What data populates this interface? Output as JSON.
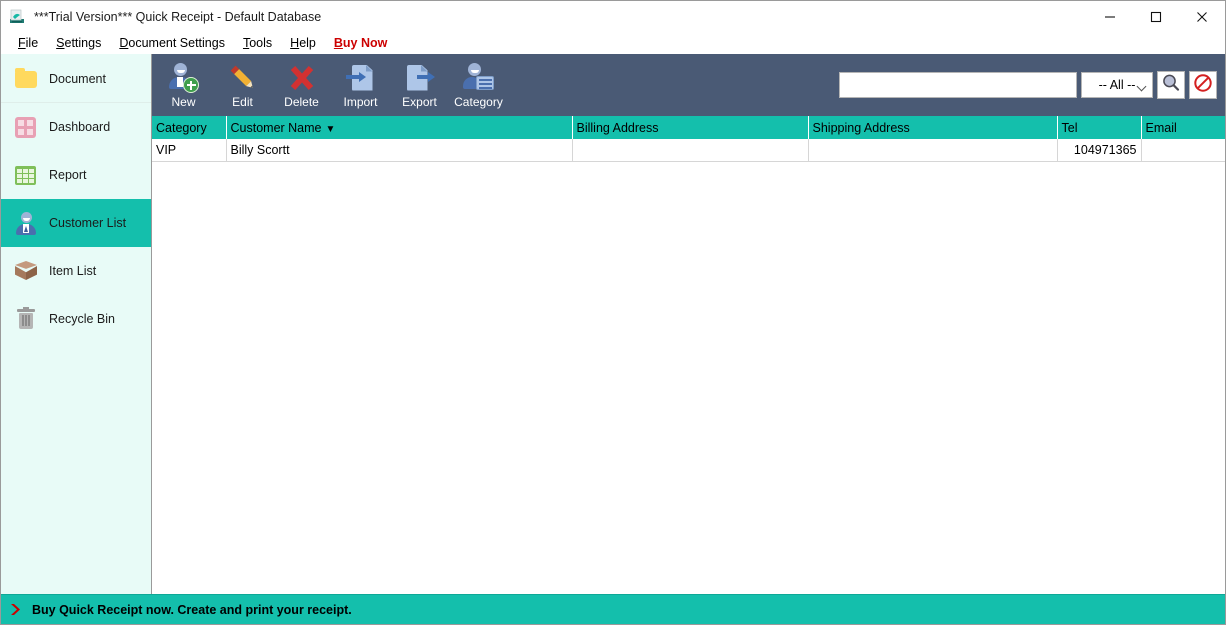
{
  "window": {
    "title": "***Trial Version*** Quick Receipt - Default Database",
    "app_icon": "app-receipt-icon",
    "controls": {
      "minimize": "minimize-icon",
      "maximize": "maximize-icon",
      "close": "close-icon"
    }
  },
  "menubar": {
    "items": [
      {
        "label": "File",
        "accel": "F",
        "highlight": false
      },
      {
        "label": "Settings",
        "accel": "S",
        "highlight": false
      },
      {
        "label": "Document Settings",
        "accel": "D",
        "highlight": false
      },
      {
        "label": "Tools",
        "accel": "T",
        "highlight": false
      },
      {
        "label": "Help",
        "accel": "H",
        "highlight": false
      },
      {
        "label": "Buy Now",
        "accel": "B",
        "highlight": true
      }
    ]
  },
  "sidebar": {
    "items": [
      {
        "label": "Document",
        "icon": "folder-icon",
        "active": false
      },
      {
        "label": "Dashboard",
        "icon": "dashboard-grid-icon",
        "active": false
      },
      {
        "label": "Report",
        "icon": "report-table-icon",
        "active": false
      },
      {
        "label": "Customer List",
        "icon": "customer-person-icon",
        "active": true
      },
      {
        "label": "Item List",
        "icon": "box-icon",
        "active": false
      },
      {
        "label": "Recycle Bin",
        "icon": "trash-icon",
        "active": false
      }
    ]
  },
  "toolbar": {
    "buttons": [
      {
        "label": "New",
        "icon": "user-add-icon"
      },
      {
        "label": "Edit",
        "icon": "pencil-icon"
      },
      {
        "label": "Delete",
        "icon": "red-x-icon"
      },
      {
        "label": "Import",
        "icon": "document-import-icon"
      },
      {
        "label": "Export",
        "icon": "document-export-icon"
      },
      {
        "label": "Category",
        "icon": "user-card-icon"
      }
    ],
    "search": {
      "value": "",
      "placeholder": "",
      "filter_selected": "-- All --",
      "search_button_icon": "magnifier-icon",
      "clear_button_icon": "no-entry-icon"
    }
  },
  "table": {
    "columns": [
      {
        "label": "Category",
        "sort": ""
      },
      {
        "label": "Customer Name",
        "sort": "▼"
      },
      {
        "label": "Billing Address",
        "sort": ""
      },
      {
        "label": "Shipping Address",
        "sort": ""
      },
      {
        "label": "Tel",
        "sort": ""
      },
      {
        "label": "Email",
        "sort": ""
      }
    ],
    "rows": [
      {
        "category": "VIP",
        "customer_name": "Billy Scortt",
        "billing_address": "",
        "shipping_address": "",
        "tel": "104971365",
        "email": ""
      }
    ]
  },
  "statusbar": {
    "icon": "red-double-chevron-icon",
    "text": "Buy Quick Receipt now. Create and print your receipt."
  },
  "colors": {
    "teal": "#14bfac",
    "toolbar_slate": "#4a5a75",
    "sidebar_bg": "#e8fbf7",
    "buy_now_red": "#cc0000"
  }
}
